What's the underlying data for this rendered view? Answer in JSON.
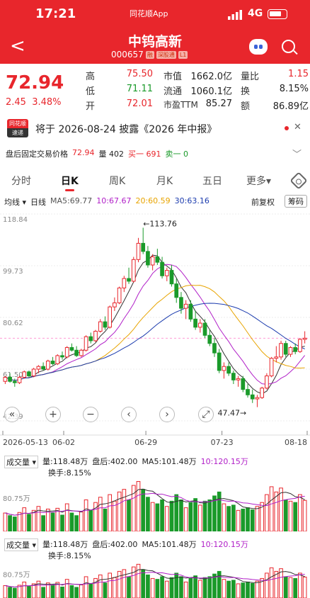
{
  "status": {
    "time": "17:21",
    "app": "同花顺App",
    "network": "4G"
  },
  "header": {
    "title": "中钨高新",
    "code": "000657",
    "tags": [
      "融",
      "深股通",
      "L1"
    ]
  },
  "quote": {
    "price": "72.94",
    "change": "2.45",
    "change_pct": "3.48%",
    "high_label": "高",
    "high": "75.50",
    "low_label": "低",
    "low": "71.11",
    "open_label": "开",
    "open": "72.01",
    "mcap_label": "市值",
    "mcap": "1662.0亿",
    "float_label": "流通",
    "float": "1060.1亿",
    "pe_label": "市盈TTM",
    "pe": "85.27",
    "vr_label": "量比",
    "vr": "1.15",
    "turn_label": "换",
    "turn": "8.15%",
    "amt_label": "额",
    "amt": "86.89亿"
  },
  "notice": {
    "logo_top": "同花顺",
    "logo_bottom": "速递",
    "text": "将于 2026-08-24 披露《2026 年中报》"
  },
  "after_hours": {
    "label": "盘后固定交易价格",
    "price": "72.94",
    "vol": "量 402",
    "buy": "买一 691",
    "sell": "卖一 0"
  },
  "tabs": [
    "分时",
    "日K",
    "周K",
    "月K",
    "五日",
    "更多▾"
  ],
  "ma": {
    "mode": "均线 ▾",
    "period": "日线",
    "ma5": "MA5:69.77",
    "ma10": "10:67.67",
    "ma20": "20:60.59",
    "ma30": "30:63.16",
    "adjust": "前复权",
    "chips": "筹码"
  },
  "chart_data": {
    "type": "candlestick",
    "y_ticks": [
      "118.84",
      "99.73",
      "80.62",
      "61.50",
      "42.39"
    ],
    "x_ticks": [
      "2026-05-13",
      "06-02",
      "06-29",
      "07-23",
      "08-18"
    ],
    "max_label": "←113.76",
    "min_label": "47.47→",
    "ylim": [
      42.39,
      118.84
    ],
    "ohlc": [
      [
        57,
        59,
        56,
        58.5
      ],
      [
        58.5,
        60,
        56.5,
        57
      ],
      [
        57,
        58,
        55,
        56.5
      ],
      [
        56.5,
        59,
        56,
        58.5
      ],
      [
        58.5,
        61,
        58,
        60.5
      ],
      [
        60.5,
        61,
        58.5,
        59
      ],
      [
        59,
        62,
        58.5,
        61.5
      ],
      [
        61.5,
        63,
        60,
        62.5
      ],
      [
        62.5,
        64,
        61,
        61.5
      ],
      [
        61.5,
        65,
        61,
        64.5
      ],
      [
        64.5,
        66,
        63,
        63.5
      ],
      [
        63.5,
        67,
        63,
        66.5
      ],
      [
        66.5,
        68,
        65,
        66
      ],
      [
        66,
        70,
        65.5,
        69.5
      ],
      [
        69.5,
        71,
        68,
        68.5
      ],
      [
        68.5,
        70,
        66,
        66.5
      ],
      [
        66.5,
        69,
        66,
        68.5
      ],
      [
        68.5,
        74,
        68,
        73.5
      ],
      [
        73.5,
        75,
        71,
        72
      ],
      [
        72,
        76,
        71.5,
        75.5
      ],
      [
        75.5,
        80,
        75,
        79
      ],
      [
        79,
        81,
        76,
        77
      ],
      [
        77,
        85,
        76.5,
        84.5
      ],
      [
        84.5,
        88,
        83,
        86
      ],
      [
        86,
        92,
        85.5,
        91.5
      ],
      [
        91.5,
        96,
        90,
        95
      ],
      [
        95,
        99,
        93,
        94
      ],
      [
        94,
        103,
        93.5,
        102
      ],
      [
        102,
        110,
        101,
        108
      ],
      [
        108,
        113.76,
        104,
        105
      ],
      [
        105,
        107,
        99,
        100
      ],
      [
        100,
        104,
        98,
        103
      ],
      [
        103,
        106,
        100,
        101
      ],
      [
        101,
        103,
        95,
        96
      ],
      [
        96,
        99,
        94,
        98
      ],
      [
        98,
        100,
        92,
        93
      ],
      [
        93,
        95,
        86,
        88
      ],
      [
        88,
        90,
        82,
        84
      ],
      [
        84,
        87,
        80,
        85.5
      ],
      [
        85.5,
        87,
        79,
        80
      ],
      [
        80,
        83,
        76,
        77
      ],
      [
        77,
        80,
        75,
        78.5
      ],
      [
        78.5,
        80,
        73,
        74
      ],
      [
        74,
        76,
        70,
        71
      ],
      [
        71,
        73,
        66,
        67.5
      ],
      [
        67.5,
        69,
        60,
        61
      ],
      [
        61,
        64,
        58,
        62.5
      ],
      [
        62.5,
        64,
        59,
        60
      ],
      [
        60,
        61,
        56,
        57.5
      ],
      [
        57.5,
        59,
        55,
        58
      ],
      [
        58,
        59,
        53,
        54
      ],
      [
        54,
        56,
        51,
        52
      ],
      [
        52,
        54,
        49,
        50.5
      ],
      [
        50.5,
        52,
        47.47,
        51
      ],
      [
        51,
        55,
        50.5,
        54.5
      ],
      [
        54.5,
        60,
        54,
        59
      ],
      [
        59,
        66,
        58.5,
        65.5
      ],
      [
        65.5,
        70,
        64,
        66
      ],
      [
        66,
        72,
        65,
        71
      ],
      [
        71,
        72,
        66,
        67
      ],
      [
        67,
        70,
        66,
        69.5
      ],
      [
        69.5,
        71,
        67,
        68
      ],
      [
        68,
        73,
        67.5,
        72.5
      ],
      [
        72.5,
        75.5,
        71,
        72.94
      ]
    ],
    "volume": {
      "label": "成交量 ▾",
      "vol": "量:118.48万",
      "after": "盘后:402.00",
      "ma5": "MA5:101.48万",
      "ma10": "10:120.15万",
      "turnover": "换手:8.15%",
      "scale": "80.75万",
      "values": [
        70,
        60,
        55,
        72,
        90,
        65,
        80,
        95,
        60,
        85,
        70,
        88,
        62,
        105,
        70,
        60,
        74,
        120,
        80,
        110,
        130,
        85,
        140,
        115,
        150,
        160,
        120,
        175,
        190,
        160,
        130,
        110,
        105,
        120,
        95,
        115,
        140,
        120,
        90,
        110,
        125,
        100,
        115,
        120,
        135,
        150,
        105,
        95,
        100,
        80,
        85,
        90,
        82,
        95,
        110,
        140,
        170,
        150,
        165,
        120,
        115,
        110,
        140,
        118
      ]
    }
  },
  "controls": [
    "«",
    "+",
    "−",
    "‹",
    "›",
    "⤢"
  ]
}
